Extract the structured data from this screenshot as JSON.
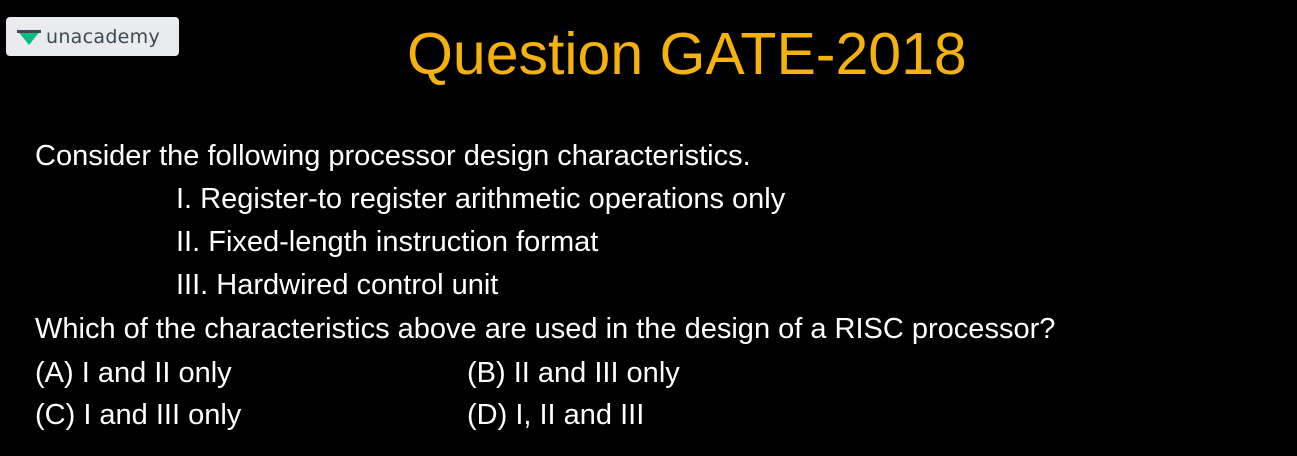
{
  "logo": {
    "text": "unacademy",
    "brand_color": "#08bd80"
  },
  "title": "Question GATE-2018",
  "question": {
    "intro": "Consider the following processor design characteristics.",
    "items": [
      "I. Register-to register arithmetic operations only",
      "II. Fixed-length instruction format",
      "III. Hardwired control unit"
    ],
    "prompt": "Which of the characteristics above are used in the design of a RISC processor?"
  },
  "options": [
    "(A) I and II only",
    "(B) II and III only",
    "(C) I and III only",
    "(D) I, II and III"
  ],
  "colors": {
    "background": "#000000",
    "title": "#f5b20d",
    "text": "#ffffff"
  }
}
